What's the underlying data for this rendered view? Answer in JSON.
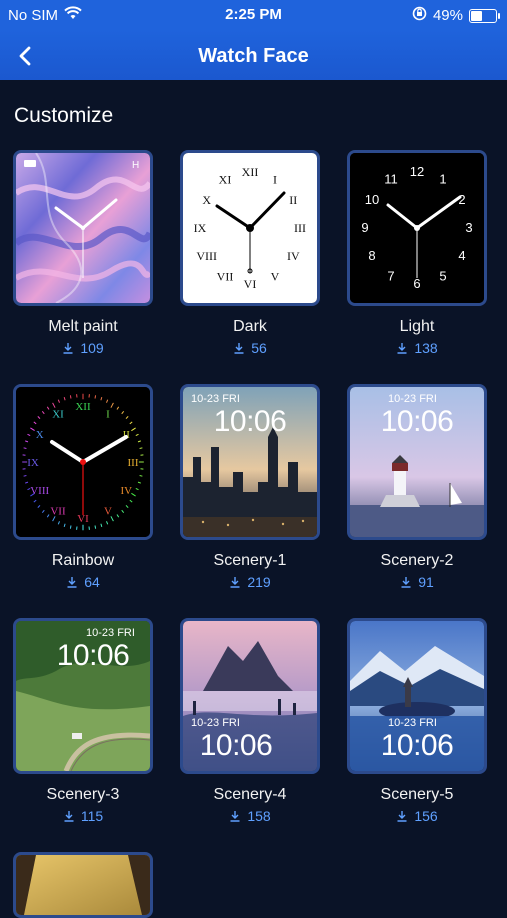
{
  "status": {
    "carrier": "No SIM",
    "time": "2:25 PM",
    "battery_pct": "49%",
    "battery_level": 0.49
  },
  "nav": {
    "title": "Watch Face"
  },
  "section": {
    "title": "Customize"
  },
  "faces": [
    {
      "name": "Melt paint",
      "downloads": "109"
    },
    {
      "name": "Dark",
      "downloads": "56"
    },
    {
      "name": "Light",
      "downloads": "138"
    },
    {
      "name": "Rainbow",
      "downloads": "64"
    },
    {
      "name": "Scenery-1",
      "downloads": "219",
      "date": "10-23 FRI",
      "time": "10:06"
    },
    {
      "name": "Scenery-2",
      "downloads": "91",
      "date": "10-23 FRI",
      "time": "10:06"
    },
    {
      "name": "Scenery-3",
      "downloads": "115",
      "date": "10-23 FRI",
      "time": "10:06"
    },
    {
      "name": "Scenery-4",
      "downloads": "158",
      "date": "10-23 FRI",
      "time": "10:06"
    },
    {
      "name": "Scenery-5",
      "downloads": "156",
      "date": "10-23 FRI",
      "time": "10:06"
    }
  ],
  "roman_numerals": [
    "XII",
    "I",
    "II",
    "III",
    "IV",
    "V",
    "VI",
    "VII",
    "VIII",
    "IX",
    "X",
    "XI"
  ],
  "arabic_numerals": [
    "12",
    "1",
    "2",
    "3",
    "4",
    "5",
    "6",
    "7",
    "8",
    "9",
    "10",
    "11"
  ],
  "colors": {
    "accent": "#1f63dc",
    "background": "#0a1327",
    "download": "#5fa0ff",
    "card_border": "#2c4a8c"
  }
}
